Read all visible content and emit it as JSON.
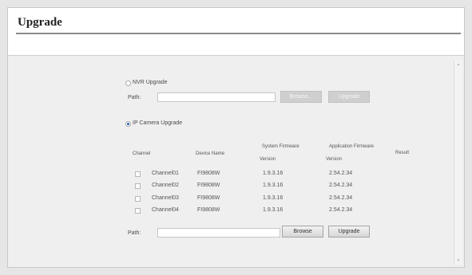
{
  "page": {
    "title": "Upgrade"
  },
  "nvr_upgrade": {
    "label": "NVR Upgrade",
    "selected": false,
    "path_label": "Path:",
    "path_value": "",
    "browse_label": "Browse...",
    "upgrade_label": "Upgrade"
  },
  "ipc_upgrade": {
    "label": "IP Camera Upgrade",
    "selected": true,
    "columns": {
      "channel": "Channel",
      "device_name": "Device Name",
      "system_firmware_1": "System Firmware",
      "system_firmware_2": "Version",
      "application_firmware_1": "Application Firmware",
      "application_firmware_2": "Version",
      "result": "Result"
    },
    "rows": [
      {
        "checked": false,
        "channel": "Channel01",
        "device_name": "FI9808W",
        "system_fw": "1.9.3.16",
        "app_fw": "2.54.2.34",
        "result": ""
      },
      {
        "checked": false,
        "channel": "Channel02",
        "device_name": "FI9808W",
        "system_fw": "1.9.3.16",
        "app_fw": "2.54.2.34",
        "result": ""
      },
      {
        "checked": false,
        "channel": "Channel03",
        "device_name": "FI9808W",
        "system_fw": "1.9.3.16",
        "app_fw": "2.54.2.34",
        "result": ""
      },
      {
        "checked": false,
        "channel": "Channel04",
        "device_name": "FI9808W",
        "system_fw": "1.9.3.16",
        "app_fw": "2.54.2.34",
        "result": ""
      }
    ],
    "path_label": "Path:",
    "path_value": "",
    "browse_label": "Browse",
    "upgrade_label": "Upgrade"
  }
}
